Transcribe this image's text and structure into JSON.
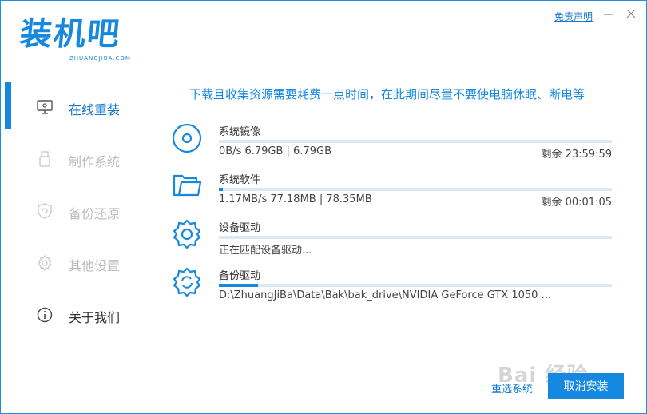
{
  "app": {
    "logo_text": "装机吧",
    "logo_sub": "ZHUANGJIBA.COM",
    "disclaimer": "免责声明"
  },
  "sidebar": {
    "items": [
      {
        "label": "在线重装",
        "icon": "monitor-icon",
        "state": "active"
      },
      {
        "label": "制作系统",
        "icon": "usb-drive-icon",
        "state": "disabled"
      },
      {
        "label": "备份还原",
        "icon": "backup-shield-icon",
        "state": "disabled"
      },
      {
        "label": "其他设置",
        "icon": "gear-icon",
        "state": "disabled"
      },
      {
        "label": "关于我们",
        "icon": "info-icon",
        "state": "normal"
      }
    ]
  },
  "main": {
    "headline": "下载且收集资源需要耗费一点时间，在此期间尽量不要使电脑休眠、断电等",
    "tasks": [
      {
        "title": "系统镜像",
        "detail": "0B/s 6.79GB | 6.79GB",
        "remaining": "剩余 23:59:59",
        "progress": 0.0,
        "icon": "disc-icon"
      },
      {
        "title": "系统软件",
        "detail": "1.17MB/s 77.18MB | 78.35MB",
        "remaining": "剩余 00:01:05",
        "progress": 0.01,
        "icon": "folder-icon"
      },
      {
        "title": "设备驱动",
        "detail": "正在匹配设备驱动...",
        "remaining": "",
        "progress": 0.0,
        "icon": "gear-icon"
      },
      {
        "title": "备份驱动",
        "detail": "D:\\ZhuangJiBa\\Data\\Bak\\bak_drive\\NVIDIA GeForce GTX 1050 ...",
        "remaining": "",
        "progress": 0.1,
        "icon": "gear-refresh-icon"
      }
    ]
  },
  "footer": {
    "reselect_label": "重选系统",
    "cancel_label": "取消安装"
  },
  "watermark": {
    "text": "Bai 经验"
  },
  "colors": {
    "accent": "#1588e0",
    "track": "#dde8f5",
    "disabled_text": "#bdbdbd"
  }
}
